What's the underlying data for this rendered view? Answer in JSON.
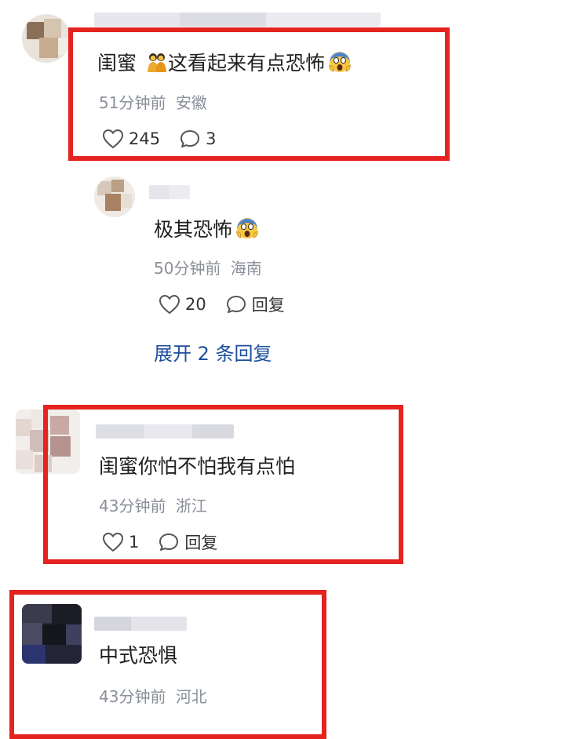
{
  "comments": [
    {
      "content_prefix": "闺蜜",
      "content_suffix": "这看起来有点恐怖",
      "time": "51分钟前",
      "location": "安徽",
      "likes": "245",
      "replies": "3"
    },
    {
      "content": "极其恐怖",
      "time": "50分钟前",
      "location": "海南",
      "likes": "20",
      "reply_label": "回复"
    },
    {
      "content": "闺蜜你怕不怕我有点怕",
      "time": "43分钟前",
      "location": "浙江",
      "likes": "1",
      "reply_label": "回复"
    },
    {
      "content": "中式恐惧",
      "time": "43分钟前",
      "location": "河北"
    }
  ],
  "expand_label": "展开 2 条回复",
  "icons": {
    "like": "heart-icon",
    "comment": "comment-bubble-icon",
    "friends_emoji": "two-people-emoji",
    "scream_emoji": "screaming-face-emoji"
  },
  "colors": {
    "highlight": "#e5231f",
    "link": "#1d4e9e",
    "meta": "#8a8f99"
  }
}
